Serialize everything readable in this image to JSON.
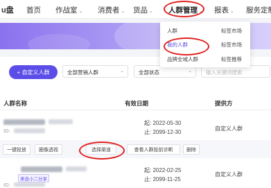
{
  "brand": {
    "logo": "u盘"
  },
  "nav": {
    "items": [
      {
        "label": "首页",
        "has_menu": false
      },
      {
        "label": "作战室",
        "has_menu": true
      },
      {
        "label": "消费者",
        "has_menu": true
      },
      {
        "label": "货品",
        "has_menu": true
      },
      {
        "label": "人群管理",
        "has_menu": true,
        "active": true
      },
      {
        "label": "报表",
        "has_menu": true
      },
      {
        "label": "服务定制",
        "has_menu": false
      }
    ],
    "chevron": "⌄"
  },
  "dropdown": {
    "col1": [
      "人群",
      "我的人群",
      "品牌全域人群"
    ],
    "col2": [
      "标签市场",
      "标签市场",
      "标签推荐"
    ],
    "selected": "我的人群"
  },
  "toolbar": {
    "add_button": "+ 自定义人群",
    "filter_channel": "全部营销人群",
    "filter_status": "全部状态",
    "search_placeholder": "输入关键词搜索"
  },
  "table": {
    "columns": [
      "人群名称",
      "有效日期",
      "提供方"
    ],
    "rows": [
      {
        "id_prefix": "ID:",
        "start_prefix": "起:",
        "start": "2022-05-30",
        "end_prefix": "止:",
        "end": "2099-12-30",
        "provider": "自定义人群"
      },
      {
        "id_prefix": "ID:",
        "start_prefix": "起:",
        "start": "2022-02-25",
        "end_prefix": "止:",
        "end": "2099-11-25",
        "provider": "自定义人群",
        "tag": "来自小二分享"
      }
    ],
    "actions": [
      "一键投放",
      "圈像透视",
      "选择渠道",
      "查看人群投前诊断",
      "删除"
    ]
  },
  "annotations": {
    "circle_color": "#e02020"
  },
  "colors": {
    "primary": "#5b4de8",
    "banner": "#8a72ee"
  }
}
